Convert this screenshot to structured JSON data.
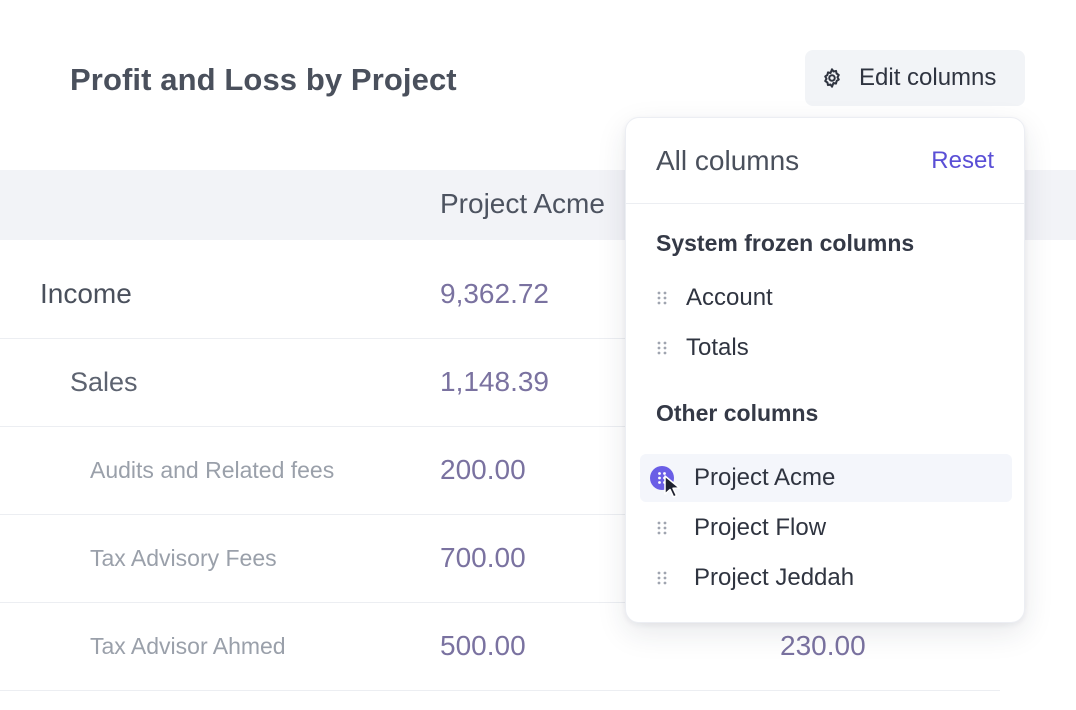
{
  "page": {
    "title": "Profit and Loss by Project"
  },
  "toolbar": {
    "edit_columns_label": "Edit columns",
    "edit_columns_icon": "gear-icon"
  },
  "table": {
    "column_header": "Project Acme",
    "rows": [
      {
        "account": "Income",
        "level": 0,
        "value": "9,362.72",
        "value2": ""
      },
      {
        "account": "Sales",
        "level": 1,
        "value": "1,148.39",
        "value2": ""
      },
      {
        "account": "Audits and Related fees",
        "level": 2,
        "value": "200.00",
        "value2": ""
      },
      {
        "account": "Tax Advisory Fees",
        "level": 2,
        "value": "700.00",
        "value2": ""
      },
      {
        "account": "Tax Advisor Ahmed",
        "level": 2,
        "value": "500.00",
        "value2": "230.00"
      }
    ]
  },
  "dropdown": {
    "title": "All columns",
    "reset_label": "Reset",
    "frozen_section": "System frozen columns",
    "frozen_items": [
      "Account",
      "Totals"
    ],
    "other_section": "Other columns",
    "other_items": [
      "Project Acme",
      "Project Flow",
      "Project Jeddah"
    ],
    "active_item_index": 0
  },
  "colors": {
    "accent": "#5a4fd6",
    "value_text": "#7a72a0",
    "drag_badge": "#6a5ee6"
  }
}
